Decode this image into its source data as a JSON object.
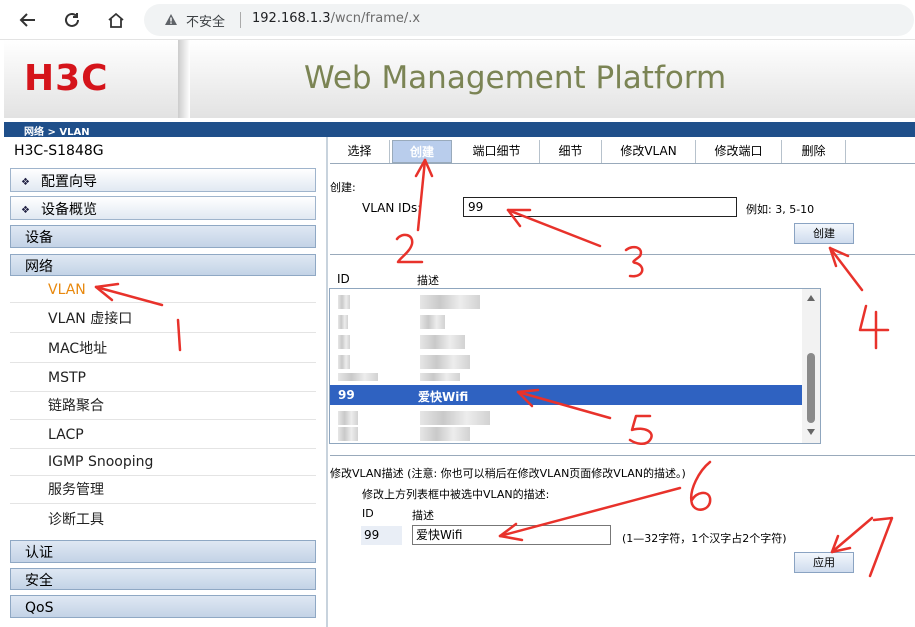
{
  "browser": {
    "insecure_label": "不安全",
    "url_host": "192.168.1.3",
    "url_path": "/wcn/frame/.x"
  },
  "header": {
    "logo_text": "H3C",
    "platform_title": "Web Management Platform"
  },
  "breadcrumb": "网络 > VLAN",
  "sidebar": {
    "device_name": "H3C-S1848G",
    "top_items": [
      "配置向导",
      "设备概览"
    ],
    "groups_top": [
      "设备",
      "网络"
    ],
    "network_items": [
      "VLAN",
      "VLAN 虚接口",
      "MAC地址",
      "MSTP",
      "链路聚合",
      "LACP",
      "IGMP Snooping",
      "服务管理",
      "诊断工具"
    ],
    "groups_bottom": [
      "认证",
      "安全",
      "QoS"
    ]
  },
  "tabs": [
    "选择",
    "创建",
    "端口细节",
    "细节",
    "修改VLAN",
    "修改端口",
    "删除"
  ],
  "create": {
    "section_label": "创建:",
    "vlan_ids_label": "VLAN IDs:",
    "vlan_ids_value": "99",
    "example_label": "例如: 3, 5-10",
    "create_button": "创建"
  },
  "list": {
    "col_id": "ID",
    "col_desc": "描述",
    "selected_id": "99",
    "selected_desc": "爱快Wifi"
  },
  "modify": {
    "section_label": "修改VLAN描述 (注意:  你也可以稍后在修改VLAN页面修改VLAN的描述。)",
    "instruction": "修改上方列表框中被选中VLAN的描述:",
    "col_id": "ID",
    "col_desc": "描述",
    "id_value": "99",
    "desc_value": "爱快Wifi",
    "hint": "(1—32字符，1个汉字占2个字符)",
    "apply_button": "应用"
  },
  "annotations": [
    "1",
    "2",
    "3",
    "4",
    "5",
    "6",
    "7"
  ],
  "colors": {
    "accent_blue": "#1f4f8a",
    "logo_red": "#d5141b",
    "active_nav": "#e8890f",
    "selection": "#2f62c1",
    "annotation_red": "#e8322b"
  }
}
